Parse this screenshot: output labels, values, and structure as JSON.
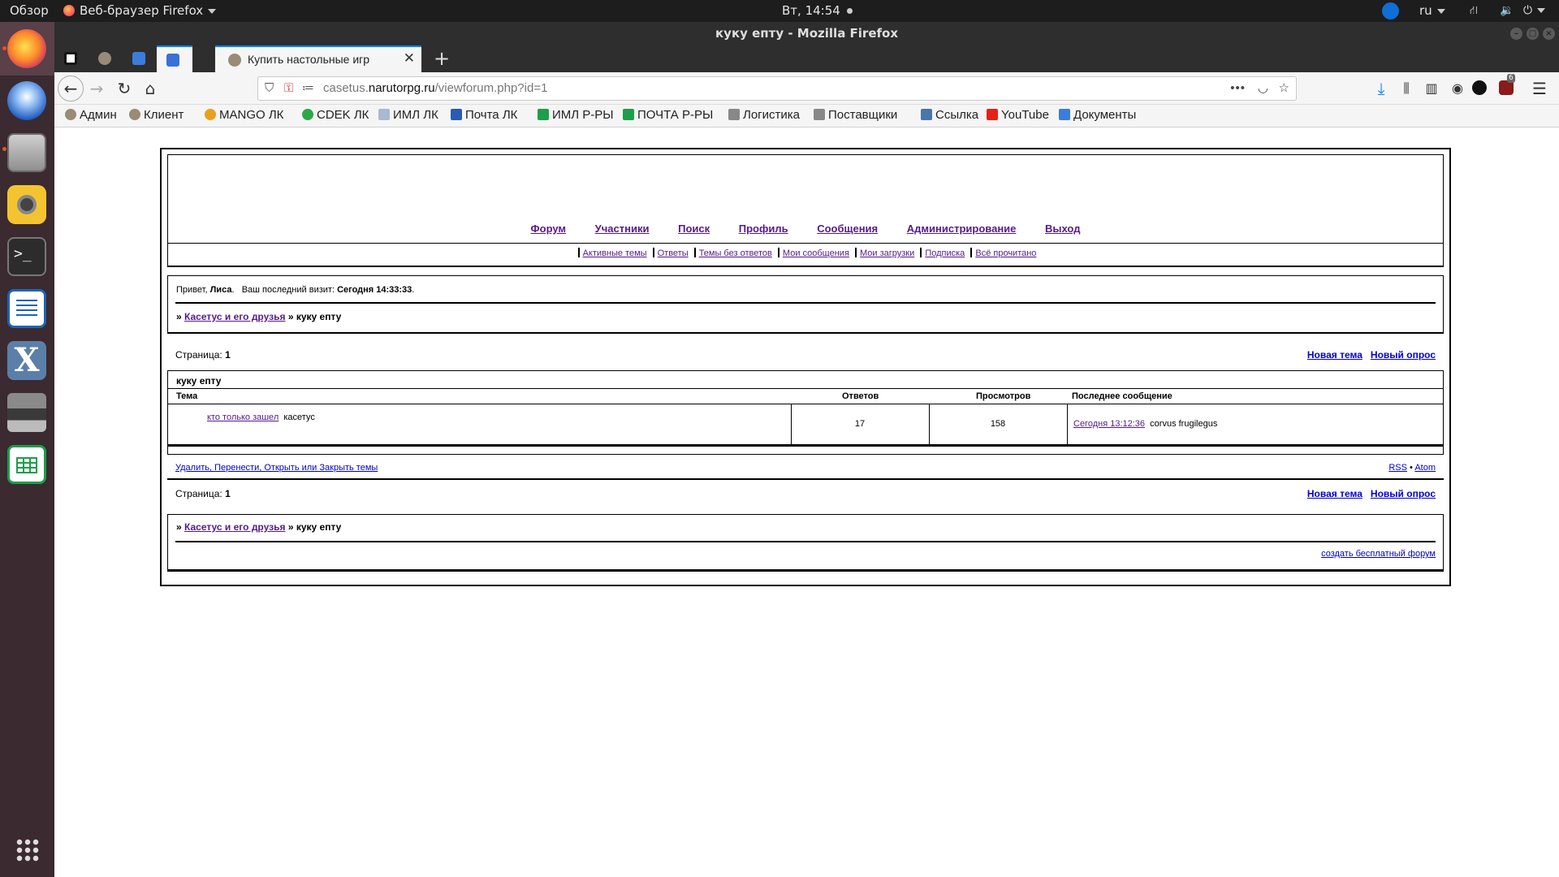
{
  "os_topbar": {
    "activities": "Обзор",
    "app_menu": "Веб-браузер Firefox",
    "clock": "Вт, 14:54",
    "language": "ru"
  },
  "window": {
    "title": "куку епту - Mozilla Firefox"
  },
  "tabs": {
    "active_title": "Купить настольные игр"
  },
  "navbar": {
    "url_prefix": "casetus.",
    "url_domain": "narutorpg.ru",
    "url_path": "/viewforum.php?id=1",
    "addon_badge": "6"
  },
  "bookmarks": [
    {
      "label": "Админ",
      "icon": "t-icon",
      "color": "#9a8a78"
    },
    {
      "label": "Клиент",
      "icon": "t-icon",
      "color": "#9a8a78"
    },
    {
      "label": "MANGO ЛК",
      "icon": "mango-icon",
      "color": "#e8a020"
    },
    {
      "label": "CDEK ЛК",
      "icon": "cdek-icon",
      "color": "#2ea84a"
    },
    {
      "label": "ИМЛ ЛК",
      "icon": "doc-icon",
      "color": "#aab8d0"
    },
    {
      "label": "Почта ЛК",
      "icon": "eagle-icon",
      "color": "#2a5bb0"
    },
    {
      "label": "ИМЛ Р-РЫ",
      "icon": "sheet-plus-icon",
      "color": "#1e9e4a"
    },
    {
      "label": "ПОЧТА Р-РЫ",
      "icon": "sheet-plus-icon",
      "color": "#1e9e4a"
    },
    {
      "label": "Логистика",
      "icon": "folder-icon",
      "color": "#888888"
    },
    {
      "label": "Поставщики",
      "icon": "folder-icon",
      "color": "#888888"
    },
    {
      "label": "Ссылка",
      "icon": "vk-icon",
      "color": "#4a76a8"
    },
    {
      "label": "YouTube",
      "icon": "youtube-icon",
      "color": "#e62117"
    },
    {
      "label": "Документы",
      "icon": "docs-icon",
      "color": "#3b7ddd"
    }
  ],
  "forum": {
    "main_nav": [
      "Форум",
      "Участники",
      "Поиск",
      "Профиль",
      "Сообщения",
      "Администрирование",
      "Выход"
    ],
    "sub_nav": [
      "Активные темы",
      "Ответы",
      "Темы без ответов",
      "Мои сообщения",
      "Мои загрузки",
      "Подписка",
      "Всё прочитано"
    ],
    "welcome_prefix": "Привет,",
    "user_name": "Лиса",
    "last_visit_label": "Ваш последний визит:",
    "last_visit_value": "Сегодня 14:33:33",
    "crumb_sep": "»",
    "crumb_forum": "Касетус и его друзья",
    "crumb_current": "куку епту",
    "page_label": "Страница:",
    "page_number": "1",
    "new_topic": "Новая тема",
    "new_poll": "Новый опрос",
    "section_title": "куку епту",
    "columns": {
      "topic": "Тема",
      "replies": "Ответов",
      "views": "Просмотров",
      "last_post": "Последнее сообщение"
    },
    "topics": [
      {
        "title": "кто только зашел",
        "author": "касетус",
        "replies": "17",
        "views": "158",
        "last_post_time": "Сегодня 13:12:36",
        "last_post_author": "corvus frugilegus"
      }
    ],
    "mod_actions": "Удалить, Перенести, Открыть или Закрыть темы",
    "rss": "RSS",
    "bullet": "•",
    "atom": "Atom",
    "footer_link": "создать бесплатный форум"
  }
}
